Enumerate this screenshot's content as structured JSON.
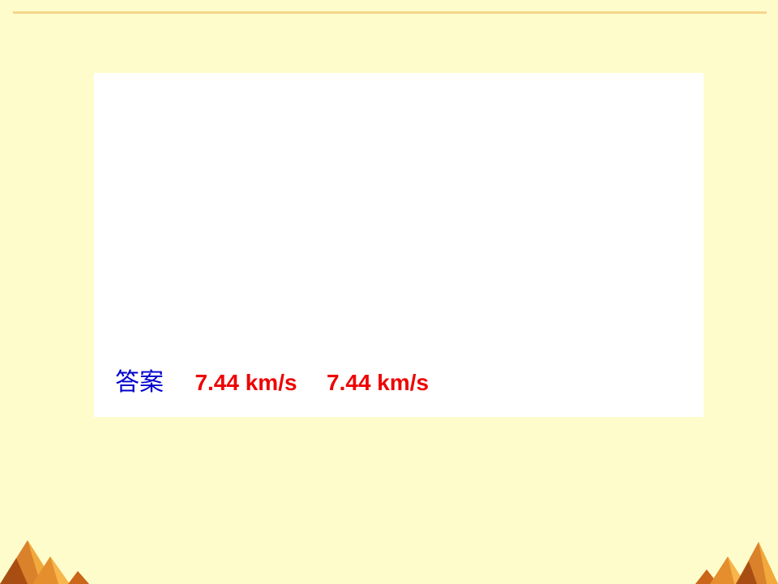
{
  "slide": {
    "background_color": "#FFFCCC",
    "rule_color": "#F8D58A",
    "panel_color": "#FFFFFF"
  },
  "answer": {
    "label": "答案",
    "label_color": "#0000CC",
    "values": [
      "7.44 km/s",
      "7.44 km/s"
    ],
    "value_color": "#EE0000"
  },
  "decorations": {
    "icons": [
      "pyramid-cluster-icon",
      "pyramid-cluster-icon"
    ],
    "colors": [
      "#D9822B",
      "#F2A93B",
      "#A84E12"
    ]
  }
}
